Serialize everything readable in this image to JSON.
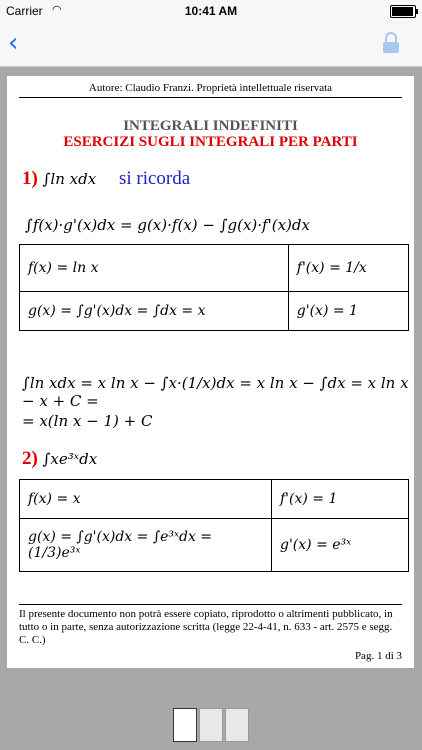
{
  "status": {
    "carrier": "Carrier",
    "time": "10:41 AM",
    "battery_percent": 95
  },
  "nav": {
    "back_icon": "chevron-left-icon",
    "lock_icon": "lock-icon"
  },
  "doc": {
    "header": "Autore: Claudio Franzi. Proprietà intellettuale riservata",
    "title1": "INTEGRALI INDEFINITI",
    "title2": "ESERCIZI SUGLI INTEGRALI  PER PARTI",
    "ex1_num": "1)",
    "ex1_expr": "∫ln xdx",
    "ex1_note": "si ricorda",
    "formula": "∫f(x)·g'(x)dx = g(x)·f(x) − ∫g(x)·f'(x)dx",
    "table1": [
      [
        "f(x) = ln x",
        "f'(x) = 1/x"
      ],
      [
        "g(x) = ∫g'(x)dx = ∫dx = x",
        "g'(x) = 1"
      ]
    ],
    "line2": "∫ln xdx = x ln x − ∫x·(1/x)dx = x ln x − ∫dx = x ln x − x + C =",
    "line3": "= x(ln x − 1) + C",
    "ex2_num": "2)",
    "ex2_expr": "∫xe³ˣdx",
    "table2": [
      [
        "f(x) = x",
        "f'(x) = 1"
      ],
      [
        "g(x) = ∫g'(x)dx = ∫e³ˣdx = (1/3)e³ˣ",
        "g'(x) = e³ˣ"
      ]
    ],
    "footer": "Il presente documento non potrà essere copiato, riprodotto o altrimenti pubblicato, in tutto o in parte, senza autorizzazione scritta (legge 22-4-41, n. 633 - art. 2575 e segg. C. C.)",
    "page": "Pag. 1 di 3"
  },
  "thumbnails_count": 3,
  "colors": {
    "accent_blue": "#1a6fe8",
    "title_red": "#e00000",
    "note_blue": "#2020c8"
  }
}
